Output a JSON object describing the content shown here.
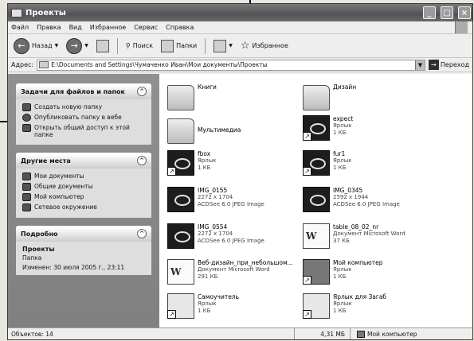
{
  "window": {
    "title": "Проекты"
  },
  "menu": [
    "Файл",
    "Правка",
    "Вид",
    "Избранное",
    "Сервис",
    "Справка"
  ],
  "toolbar": {
    "back_label": "Назад",
    "search_label": "Поиск",
    "folders_label": "Папки",
    "favorites_label": "Избранное"
  },
  "address": {
    "label": "Адрес:",
    "value": "E:\\Documents and Settings\\Чумаченко Иван\\Мои документы\\Проекты",
    "go_label": "Переход"
  },
  "tasks_panel": {
    "title": "Задачи для файлов и папок",
    "items": [
      "Создать новую папку",
      "Опубликовать папку в вебе",
      "Открыть общий доступ к этой папке"
    ]
  },
  "places_panel": {
    "title": "Другие места",
    "items": [
      "Мои документы",
      "Общие документы",
      "Мой компьютер",
      "Сетевое окружение"
    ]
  },
  "details_panel": {
    "title": "Подробно",
    "name": "Проекты",
    "type": "Папка",
    "modified": "Изменен: 30 июля 2005 г., 23:11"
  },
  "files": [
    {
      "name": "Книги",
      "line1": "",
      "line2": "",
      "icon": "folder-icon"
    },
    {
      "name": "Дизайн",
      "line1": "",
      "line2": "",
      "icon": "folder-icon"
    },
    {
      "name": "Мультимедиа",
      "line1": "",
      "line2": "",
      "icon": "folder-icon"
    },
    {
      "name": "expect",
      "line1": "Ярлык",
      "line2": "1 КБ",
      "icon": "shortcut-icon"
    },
    {
      "name": "fbox",
      "line1": "Ярлык",
      "line2": "1 КБ",
      "icon": "shortcut-icon"
    },
    {
      "name": "fur1",
      "line1": "Ярлык",
      "line2": "1 КБ",
      "icon": "shortcut-icon"
    },
    {
      "name": "IMG_0155",
      "line1": "2272 x 1704",
      "line2": "ACDSee 6.0 JPEG Image",
      "icon": "image-icon"
    },
    {
      "name": "IMG_0345",
      "line1": "2592 x 1944",
      "line2": "ACDSee 6.0 JPEG Image",
      "icon": "image-icon"
    },
    {
      "name": "IMG_0554",
      "line1": "2272 x 1704",
      "line2": "ACDSee 6.0 JPEG Image",
      "icon": "image-icon"
    },
    {
      "name": "table_08_02_nr",
      "line1": "Документ Microsoft Word",
      "line2": "37 КБ",
      "icon": "word-doc-icon"
    },
    {
      "name": "Веб-дизайн_при_небольшом...",
      "line1": "Документ Microsoft Word",
      "line2": "291 КБ",
      "icon": "word-doc-icon"
    },
    {
      "name": "Мой компьютер",
      "line1": "Ярлык",
      "line2": "1 КБ",
      "icon": "my-computer-icon"
    },
    {
      "name": "Самоучитель",
      "line1": "Ярлык",
      "line2": "1 КБ",
      "icon": "shortcut-icon"
    },
    {
      "name": "Ярлык для Загаб",
      "line1": "Ярлык",
      "line2": "1 КБ",
      "icon": "shortcut-icon"
    }
  ],
  "status": {
    "objects": "Объектов: 14",
    "size": "4,31 МБ",
    "location": "Мой компьютер"
  }
}
